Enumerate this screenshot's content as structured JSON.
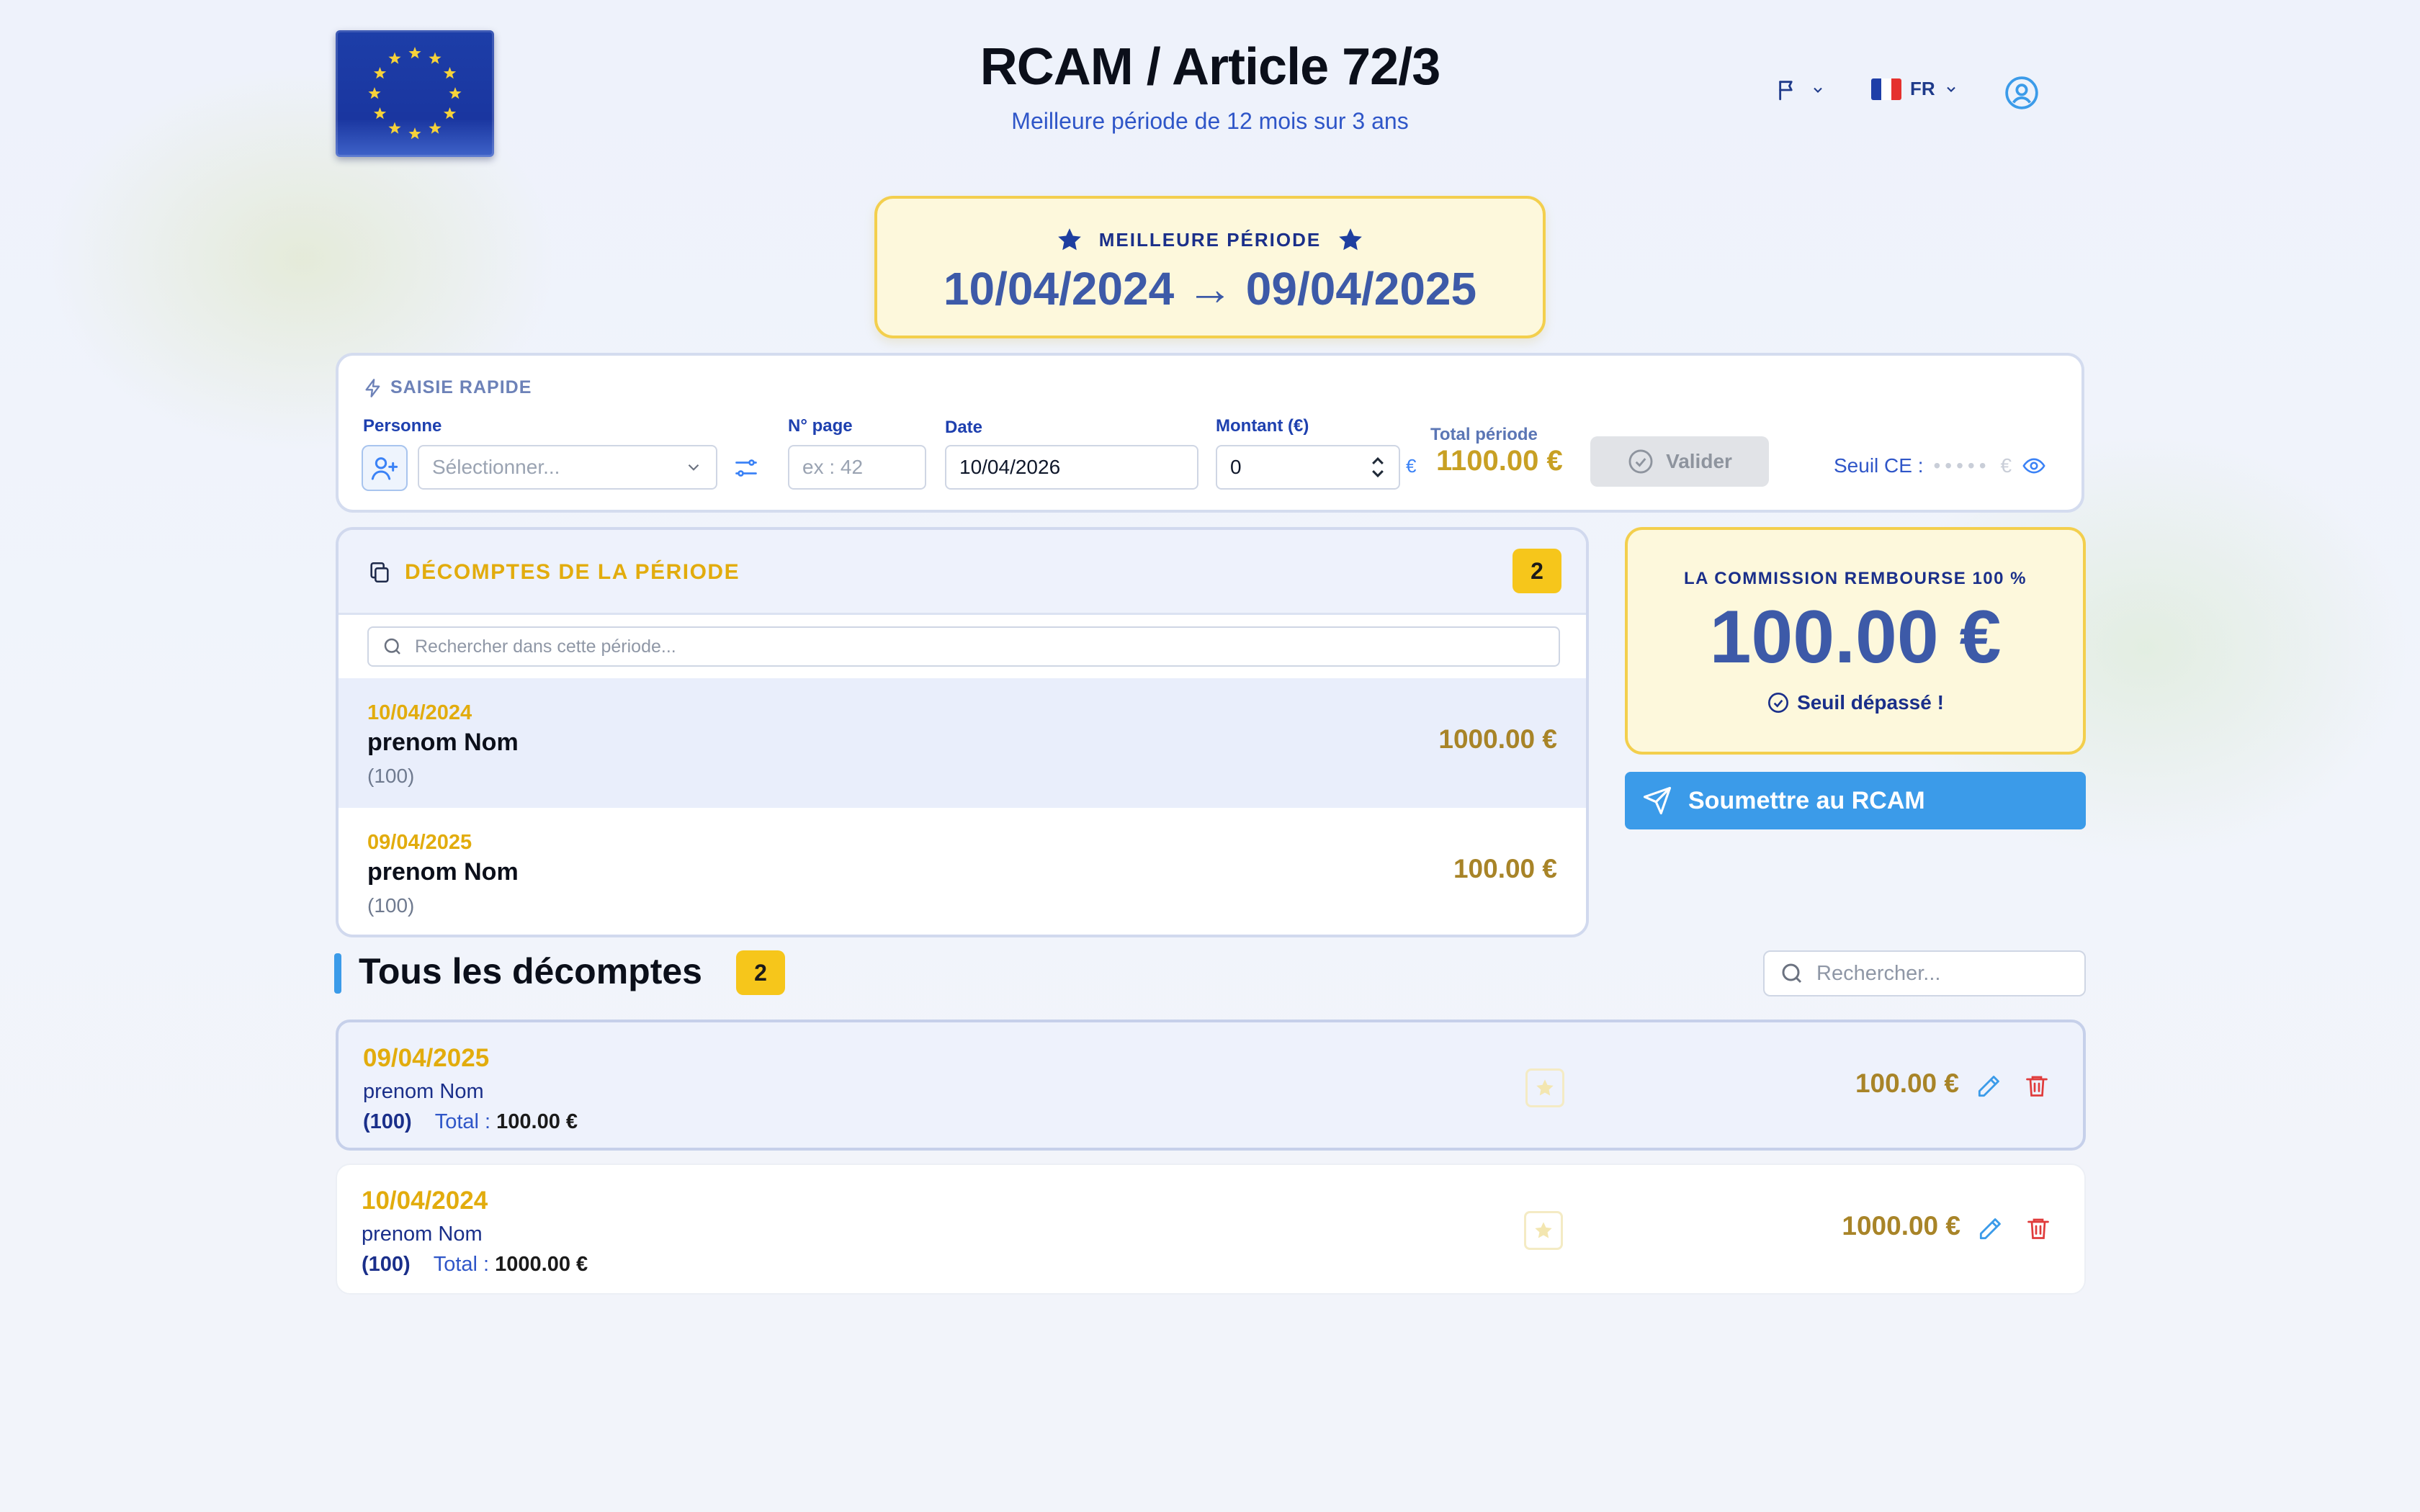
{
  "header": {
    "title": "RCAM / Article 72/3",
    "subtitle": "Meilleure période de 12 mois sur 3 ans",
    "language": "FR",
    "logo_icon": "eu-flag-icon"
  },
  "best_period": {
    "label": "MEILLEURE PÉRIODE",
    "range": "10/04/2024 → 09/04/2025"
  },
  "quick_entry": {
    "title": "SAISIE RAPIDE",
    "person_label": "Personne",
    "person_placeholder": "Sélectionner...",
    "page_label": "N° page",
    "page_placeholder": "ex : 42",
    "date_label": "Date",
    "date_value": "10/04/2026",
    "amount_label": "Montant (€)",
    "amount_value": "0",
    "currency": "€",
    "total_label": "Total période",
    "total_value": "1100.00 €",
    "validate_label": "Valider",
    "threshold_label": "Seuil CE :",
    "threshold_masked": "•••••",
    "threshold_currency": "€"
  },
  "period": {
    "title": "DÉCOMPTES DE LA PÉRIODE",
    "count": "2",
    "search_placeholder": "Rechercher dans cette période...",
    "items": [
      {
        "date": "10/04/2024",
        "name": "prenom Nom",
        "number": "(100)",
        "amount": "1000.00 €"
      },
      {
        "date": "09/04/2025",
        "name": "prenom Nom",
        "number": "(100)",
        "amount": "100.00 €"
      }
    ]
  },
  "commission": {
    "label": "LA COMMISSION REMBOURSE 100 %",
    "value": "100.00 €",
    "status": "Seuil dépassé !"
  },
  "submit_label": "Soumettre au RCAM",
  "all_records": {
    "title": "Tous les décomptes",
    "count": "2",
    "search_placeholder": "Rechercher...",
    "total_prefix": "Total :",
    "items": [
      {
        "date": "09/04/2025",
        "name": "prenom Nom",
        "number": "(100)",
        "total": "100.00 €",
        "amount": "100.00 €"
      },
      {
        "date": "10/04/2024",
        "name": "prenom Nom",
        "number": "(100)",
        "total": "1000.00 €",
        "amount": "1000.00 €"
      }
    ]
  },
  "colors": {
    "accent_blue": "#3b9be9",
    "gold": "#e2ac0d",
    "navy": "#1a2f8a",
    "amount": "#a88428"
  }
}
